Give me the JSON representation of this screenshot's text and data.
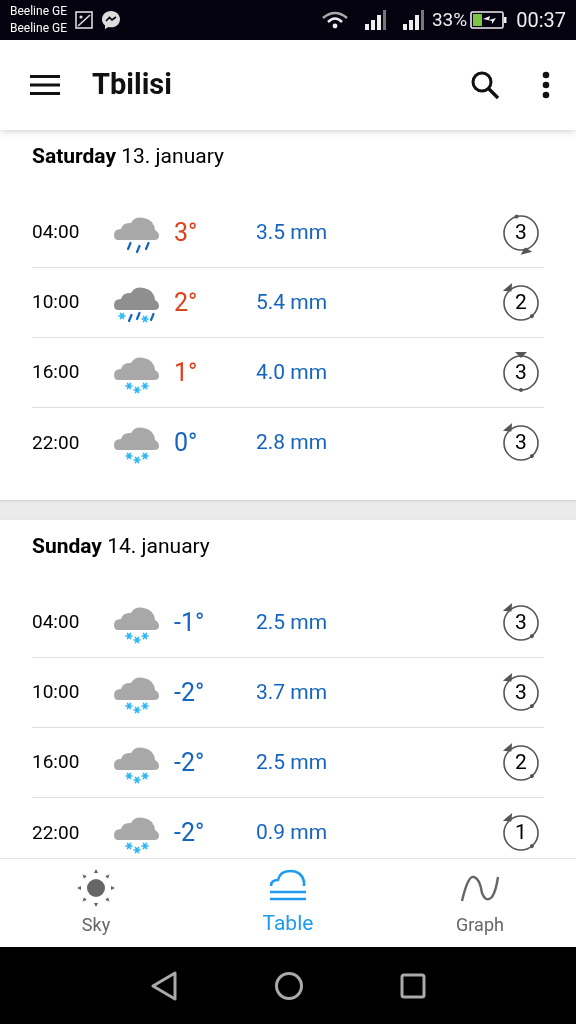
{
  "status_bar": {
    "carriers": [
      "Beeline GE",
      "Beeline GE"
    ],
    "battery": "33%",
    "time": "00:37"
  },
  "app_bar": {
    "title": "Tbilisi"
  },
  "days": [
    {
      "weekday": "Saturday",
      "date": "13. january",
      "rows": [
        {
          "time": "04:00",
          "kind": "rain",
          "temp": "3°",
          "warm": true,
          "precip": "3.5 mm",
          "wind": {
            "value": "3",
            "kind": "bottom"
          }
        },
        {
          "time": "10:00",
          "kind": "sleet",
          "temp": "2°",
          "warm": true,
          "precip": "5.4 mm",
          "wind": {
            "value": "2",
            "kind": "topleft"
          }
        },
        {
          "time": "16:00",
          "kind": "snow",
          "temp": "1°",
          "warm": true,
          "precip": "4.0 mm",
          "wind": {
            "value": "3",
            "kind": "top"
          }
        },
        {
          "time": "22:00",
          "kind": "snow",
          "temp": "0°",
          "warm": false,
          "precip": "2.8 mm",
          "wind": {
            "value": "3",
            "kind": "topleft"
          }
        }
      ]
    },
    {
      "weekday": "Sunday",
      "date": "14. january",
      "rows": [
        {
          "time": "04:00",
          "kind": "snow",
          "temp": "-1°",
          "warm": false,
          "precip": "2.5 mm",
          "wind": {
            "value": "3",
            "kind": "topleft"
          }
        },
        {
          "time": "10:00",
          "kind": "snow",
          "temp": "-2°",
          "warm": false,
          "precip": "3.7 mm",
          "wind": {
            "value": "3",
            "kind": "topleft"
          }
        },
        {
          "time": "16:00",
          "kind": "snow",
          "temp": "-2°",
          "warm": false,
          "precip": "2.5 mm",
          "wind": {
            "value": "2",
            "kind": "topleft"
          }
        },
        {
          "time": "22:00",
          "kind": "snow",
          "temp": "-2°",
          "warm": false,
          "precip": "0.9 mm",
          "wind": {
            "value": "1",
            "kind": "topleft"
          }
        }
      ]
    }
  ],
  "tabs": [
    {
      "label": "Sky",
      "kind": "sky",
      "selected": false
    },
    {
      "label": "Table",
      "kind": "table",
      "selected": true
    },
    {
      "label": "Graph",
      "kind": "graph",
      "selected": false
    }
  ]
}
